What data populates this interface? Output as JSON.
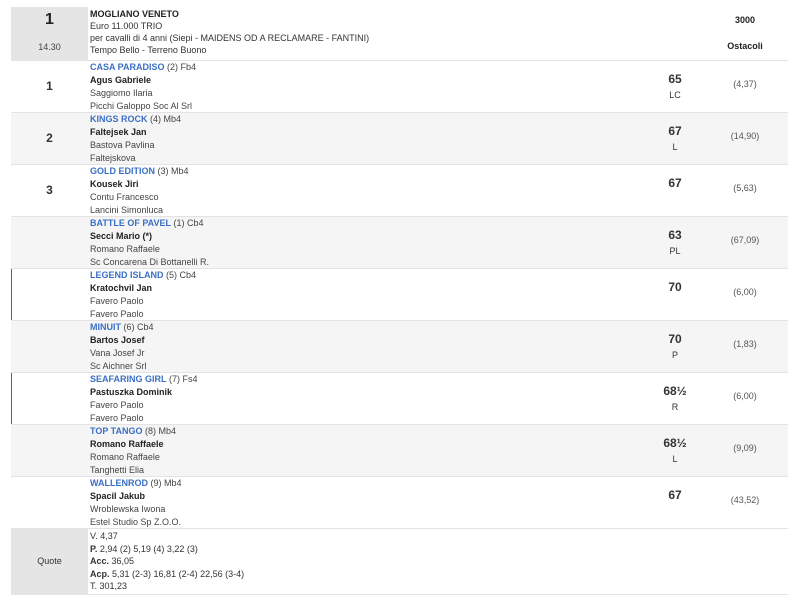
{
  "race": {
    "number": "1",
    "time": "14.30",
    "venue": "MOGLIANO VENETO",
    "prize": "Euro 11.000 TRIO",
    "conditions": "per cavalli di 4 anni (Siepi -  MAIDENS OD A RECLAMARE  - FANTINI)",
    "weather": "Tempo Bello - Terreno Buono",
    "distance": "3000",
    "type": "Ostacoli"
  },
  "runners": [
    {
      "pos": "1",
      "name": "CASA PARADISO",
      "meta": "(2) Fb4",
      "jockey": "Agus Gabriele",
      "trainer": "Saggiomo Ilaria",
      "owner": "Picchi Galoppo Soc Al Srl",
      "weight": "65",
      "tag": "LC",
      "odds": "(4,37)"
    },
    {
      "pos": "2",
      "name": "KINGS ROCK",
      "meta": "(4) Mb4",
      "jockey": "Faltejsek Jan",
      "trainer": "Bastova Pavlina",
      "owner": "Faltejskova",
      "weight": "67",
      "tag": "L",
      "odds": "(14,90)"
    },
    {
      "pos": "3",
      "name": "GOLD EDITION",
      "meta": "(3) Mb4",
      "jockey": "Kousek Jiri",
      "trainer": "Contu Francesco",
      "owner": "Lancini Simonluca",
      "weight": "67",
      "tag": "",
      "odds": "(5,63)"
    },
    {
      "pos": "",
      "name": "BATTLE OF PAVEL",
      "meta": "(1) Cb4",
      "jockey": "Secci Mario (*)",
      "trainer": "Romano Raffaele",
      "owner": "Sc Concarena Di Bottanelli R.",
      "weight": "63",
      "tag": "PL",
      "odds": "(67,09)"
    },
    {
      "pos": "",
      "name": "LEGEND ISLAND",
      "meta": "(5) Cb4",
      "jockey": "Kratochvil Jan",
      "trainer": "Favero Paolo",
      "owner": "Favero Paolo",
      "weight": "70",
      "tag": "",
      "odds": "(6,00)"
    },
    {
      "pos": "",
      "name": "MINUIT",
      "meta": "(6) Cb4",
      "jockey": "Bartos Josef",
      "trainer": "Vana Josef Jr",
      "owner": "Sc Aichner Srl",
      "weight": "70",
      "tag": "P",
      "odds": "(1,83)"
    },
    {
      "pos": "",
      "name": "SEAFARING GIRL",
      "meta": "(7) Fs4",
      "jockey": "Pastuszka Dominik",
      "trainer": "Favero Paolo",
      "owner": "Favero Paolo",
      "weight": "68½",
      "tag": "R",
      "odds": "(6,00)"
    },
    {
      "pos": "",
      "name": "TOP TANGO",
      "meta": "(8) Mb4",
      "jockey": "Romano Raffaele",
      "trainer": "Romano Raffaele",
      "owner": "Tanghetti Elia",
      "weight": "68½",
      "tag": "L",
      "odds": "(9,09)"
    },
    {
      "pos": "",
      "name": "WALLENROD",
      "meta": "(9) Mb4",
      "jockey": "Spacil Jakub",
      "trainer": "Wroblewska Iwona",
      "owner": "Estel Studio Sp Z.O.O.",
      "weight": "67",
      "tag": "",
      "odds": "(43,52)"
    }
  ],
  "quote": {
    "label": "Quote",
    "v_label": "V.",
    "v_value": "4,37",
    "p_label": "P.",
    "p_value": "2,94 (2)  5,19 (4)  3,22 (3)",
    "acc_label": "Acc.",
    "acc_value": "36,05",
    "acp_label": "Acp.",
    "acp_value": "5,31 (2-3)  16,81 (2-4)  22,56 (3-4)",
    "t_label": "T.",
    "t_value": "301,23"
  }
}
